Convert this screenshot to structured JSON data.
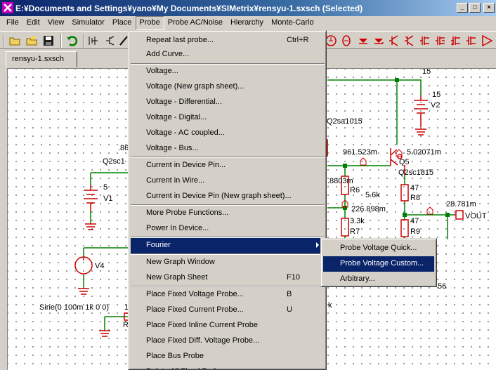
{
  "window": {
    "title": "E:¥Documents and Settings¥yano¥My Documents¥SIMetrix¥rensyu-1.sxsch (Selected)",
    "buttons": [
      "_",
      "□",
      "×"
    ]
  },
  "menubar": {
    "items": [
      "File",
      "Edit",
      "View",
      "Simulator",
      "Place",
      "Probe",
      "Probe AC/Noise",
      "Hierarchy",
      "Monte-Carlo"
    ],
    "active": "Probe"
  },
  "toolbar": {
    "icons": [
      "open-folder-icon",
      "new-folder-icon",
      "save-icon",
      "undo-icon",
      "rotate-icon",
      "mirror-icon",
      "wire-icon"
    ],
    "probe_icons": [
      "voltage-probe-icon",
      "current-probe-icon",
      "diode-icon",
      "diode-icon",
      "npn-icon",
      "pnp-icon",
      "nmos-icon",
      "pmos-icon",
      "opamp-icon"
    ]
  },
  "tabs": [
    "rensyu-1.sxsch"
  ],
  "probe_menu": {
    "items": [
      {
        "label": "Repeat last probe...",
        "shortcut": "Ctrl+R"
      },
      {
        "label": "Add Curve...",
        "shortcut": ""
      },
      {
        "label": "Voltage...",
        "shortcut": ""
      },
      {
        "label": "Voltage (New graph sheet)...",
        "shortcut": ""
      },
      {
        "label": "Voltage - Differential...",
        "shortcut": ""
      },
      {
        "label": "Voltage - Digital...",
        "shortcut": ""
      },
      {
        "label": "Voltage - AC coupled...",
        "shortcut": ""
      },
      {
        "label": "Voltage - Bus...",
        "shortcut": ""
      },
      {
        "label": "Current in Device Pin...",
        "shortcut": ""
      },
      {
        "label": "Current in Wire...",
        "shortcut": ""
      },
      {
        "label": "Current in Device Pin (New graph sheet)...",
        "shortcut": ""
      },
      {
        "label": "More Probe Functions...",
        "shortcut": ""
      },
      {
        "label": "Power In Device...",
        "shortcut": ""
      },
      {
        "label": "Fourier",
        "shortcut": ""
      },
      {
        "label": "New Graph Window",
        "shortcut": ""
      },
      {
        "label": "New Graph Sheet",
        "shortcut": "F10"
      },
      {
        "label": "Place Fixed Voltage Probe...",
        "shortcut": "B"
      },
      {
        "label": "Place Fixed Current Probe...",
        "shortcut": "U"
      },
      {
        "label": "Place Fixed Inline Current Probe",
        "shortcut": ""
      },
      {
        "label": "Place Fixed Diff. Voltage Probe...",
        "shortcut": ""
      },
      {
        "label": "Place Bus Probe",
        "shortcut": ""
      },
      {
        "label": "Delete All Fixed Probes",
        "shortcut": ""
      }
    ],
    "highlighted": "Fourier"
  },
  "fourier_submenu": {
    "items": [
      "Probe Voltage Quick...",
      "Probe Voltage Custom...",
      "Arbitrary..."
    ],
    "highlighted": "Probe Voltage Custom..."
  },
  "schematic": {
    "labels": [
      "15",
      "V2",
      "Q2sa1015",
      "961.523m",
      "5.02071m",
      "Q5",
      "Q2sc1815",
      "5.6k",
      ".8803m",
      "R6",
      "47",
      "R8",
      "226.898m",
      "28.781m",
      "VOUT",
      "3.3k",
      "R7",
      "47",
      "R9",
      "5",
      "V1",
      "V4",
      "Sine(0 100m 1k 0 0)",
      "1",
      ".86",
      "Q2sc1",
      "R",
      "k",
      "56"
    ]
  }
}
